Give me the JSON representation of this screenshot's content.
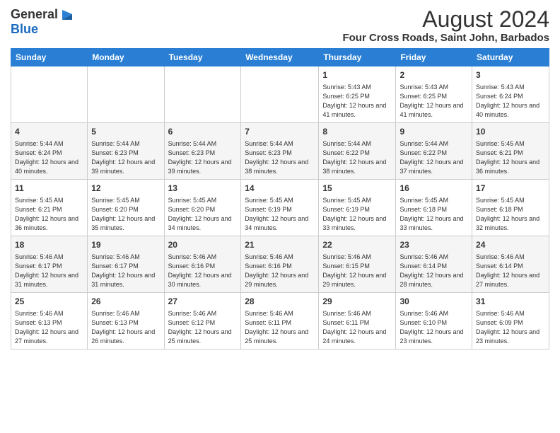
{
  "logo": {
    "general": "General",
    "blue": "Blue"
  },
  "title": "August 2024",
  "subtitle": "Four Cross Roads, Saint John, Barbados",
  "headers": [
    "Sunday",
    "Monday",
    "Tuesday",
    "Wednesday",
    "Thursday",
    "Friday",
    "Saturday"
  ],
  "weeks": [
    [
      {
        "day": "",
        "info": ""
      },
      {
        "day": "",
        "info": ""
      },
      {
        "day": "",
        "info": ""
      },
      {
        "day": "",
        "info": ""
      },
      {
        "day": "1",
        "info": "Sunrise: 5:43 AM\nSunset: 6:25 PM\nDaylight: 12 hours and 41 minutes."
      },
      {
        "day": "2",
        "info": "Sunrise: 5:43 AM\nSunset: 6:25 PM\nDaylight: 12 hours and 41 minutes."
      },
      {
        "day": "3",
        "info": "Sunrise: 5:43 AM\nSunset: 6:24 PM\nDaylight: 12 hours and 40 minutes."
      }
    ],
    [
      {
        "day": "4",
        "info": "Sunrise: 5:44 AM\nSunset: 6:24 PM\nDaylight: 12 hours and 40 minutes."
      },
      {
        "day": "5",
        "info": "Sunrise: 5:44 AM\nSunset: 6:23 PM\nDaylight: 12 hours and 39 minutes."
      },
      {
        "day": "6",
        "info": "Sunrise: 5:44 AM\nSunset: 6:23 PM\nDaylight: 12 hours and 39 minutes."
      },
      {
        "day": "7",
        "info": "Sunrise: 5:44 AM\nSunset: 6:23 PM\nDaylight: 12 hours and 38 minutes."
      },
      {
        "day": "8",
        "info": "Sunrise: 5:44 AM\nSunset: 6:22 PM\nDaylight: 12 hours and 38 minutes."
      },
      {
        "day": "9",
        "info": "Sunrise: 5:44 AM\nSunset: 6:22 PM\nDaylight: 12 hours and 37 minutes."
      },
      {
        "day": "10",
        "info": "Sunrise: 5:45 AM\nSunset: 6:21 PM\nDaylight: 12 hours and 36 minutes."
      }
    ],
    [
      {
        "day": "11",
        "info": "Sunrise: 5:45 AM\nSunset: 6:21 PM\nDaylight: 12 hours and 36 minutes."
      },
      {
        "day": "12",
        "info": "Sunrise: 5:45 AM\nSunset: 6:20 PM\nDaylight: 12 hours and 35 minutes."
      },
      {
        "day": "13",
        "info": "Sunrise: 5:45 AM\nSunset: 6:20 PM\nDaylight: 12 hours and 34 minutes."
      },
      {
        "day": "14",
        "info": "Sunrise: 5:45 AM\nSunset: 6:19 PM\nDaylight: 12 hours and 34 minutes."
      },
      {
        "day": "15",
        "info": "Sunrise: 5:45 AM\nSunset: 6:19 PM\nDaylight: 12 hours and 33 minutes."
      },
      {
        "day": "16",
        "info": "Sunrise: 5:45 AM\nSunset: 6:18 PM\nDaylight: 12 hours and 33 minutes."
      },
      {
        "day": "17",
        "info": "Sunrise: 5:45 AM\nSunset: 6:18 PM\nDaylight: 12 hours and 32 minutes."
      }
    ],
    [
      {
        "day": "18",
        "info": "Sunrise: 5:46 AM\nSunset: 6:17 PM\nDaylight: 12 hours and 31 minutes."
      },
      {
        "day": "19",
        "info": "Sunrise: 5:46 AM\nSunset: 6:17 PM\nDaylight: 12 hours and 31 minutes."
      },
      {
        "day": "20",
        "info": "Sunrise: 5:46 AM\nSunset: 6:16 PM\nDaylight: 12 hours and 30 minutes."
      },
      {
        "day": "21",
        "info": "Sunrise: 5:46 AM\nSunset: 6:16 PM\nDaylight: 12 hours and 29 minutes."
      },
      {
        "day": "22",
        "info": "Sunrise: 5:46 AM\nSunset: 6:15 PM\nDaylight: 12 hours and 29 minutes."
      },
      {
        "day": "23",
        "info": "Sunrise: 5:46 AM\nSunset: 6:14 PM\nDaylight: 12 hours and 28 minutes."
      },
      {
        "day": "24",
        "info": "Sunrise: 5:46 AM\nSunset: 6:14 PM\nDaylight: 12 hours and 27 minutes."
      }
    ],
    [
      {
        "day": "25",
        "info": "Sunrise: 5:46 AM\nSunset: 6:13 PM\nDaylight: 12 hours and 27 minutes."
      },
      {
        "day": "26",
        "info": "Sunrise: 5:46 AM\nSunset: 6:13 PM\nDaylight: 12 hours and 26 minutes."
      },
      {
        "day": "27",
        "info": "Sunrise: 5:46 AM\nSunset: 6:12 PM\nDaylight: 12 hours and 25 minutes."
      },
      {
        "day": "28",
        "info": "Sunrise: 5:46 AM\nSunset: 6:11 PM\nDaylight: 12 hours and 25 minutes."
      },
      {
        "day": "29",
        "info": "Sunrise: 5:46 AM\nSunset: 6:11 PM\nDaylight: 12 hours and 24 minutes."
      },
      {
        "day": "30",
        "info": "Sunrise: 5:46 AM\nSunset: 6:10 PM\nDaylight: 12 hours and 23 minutes."
      },
      {
        "day": "31",
        "info": "Sunrise: 5:46 AM\nSunset: 6:09 PM\nDaylight: 12 hours and 23 minutes."
      }
    ]
  ]
}
